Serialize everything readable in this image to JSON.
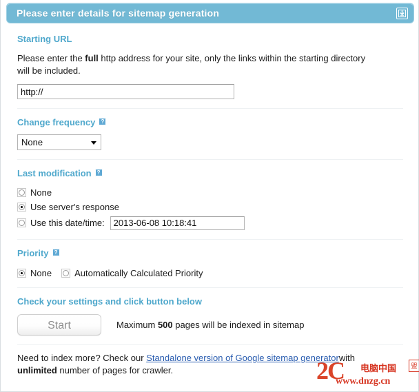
{
  "header": {
    "title": "Please enter details for sitemap generation",
    "action_icon": "download-arrow-icon"
  },
  "starting_url": {
    "section_title": "Starting URL",
    "description_prefix": "Please enter the ",
    "description_bold": "full",
    "description_suffix": " http address for your site, only the links within the starting directory will be included.",
    "input_value": "http://"
  },
  "change_frequency": {
    "section_title": "Change frequency",
    "help_icon": "question-mark-icon",
    "selected": "None",
    "options": [
      "None"
    ]
  },
  "last_modification": {
    "section_title": "Last modification",
    "help_icon": "question-mark-icon",
    "options": [
      {
        "label": "None",
        "checked": false
      },
      {
        "label": "Use server's response",
        "checked": true
      },
      {
        "label": "Use this date/time:",
        "checked": false
      }
    ],
    "date_value": "2013-06-08 10:18:41"
  },
  "priority": {
    "section_title": "Priority",
    "help_icon": "question-mark-icon",
    "options": [
      {
        "label": "None",
        "checked": true
      },
      {
        "label": "Automatically Calculated Priority",
        "checked": false
      }
    ]
  },
  "submit": {
    "section_title": "Check your settings and click button below",
    "button_label": "Start",
    "note_prefix": "Maximum ",
    "note_bold": "500",
    "note_suffix": " pages will be indexed in sitemap"
  },
  "footer": {
    "line1_prefix": "Need to index more? Check our ",
    "link_text": "Standalone version of Google sitemap generator",
    "line2_prefix": "with ",
    "line2_bold": "unlimited",
    "line2_suffix": " number of pages for crawler."
  },
  "watermark": {
    "number": "2C",
    "chinese": "电脑中国",
    "url": "www.dnzg.cn",
    "badge": "盟"
  },
  "colors": {
    "header_bg": "#72b9d5",
    "section_title": "#4fa8cc",
    "link": "#2a5db0",
    "watermark": "#d42a16"
  }
}
